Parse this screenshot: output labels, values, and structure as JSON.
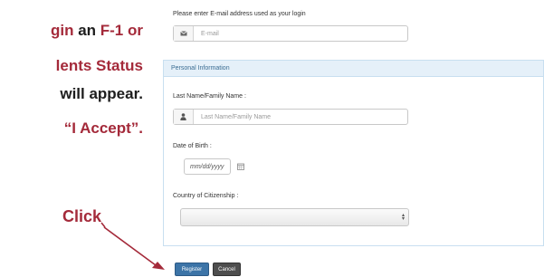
{
  "instructions": {
    "line1_red": "gin",
    "line1_dark": " an ",
    "line1_red2": "F-1 or",
    "line2": "lents Status",
    "line3": "will appear.",
    "line4": "“I Accept”."
  },
  "callout": {
    "click_label": "Click"
  },
  "form": {
    "email_instruction": "Please enter E-mail address used as your login",
    "email_placeholder": "E-mail",
    "section_title": "Personal Information",
    "last_name_label": "Last Name/Family Name :",
    "last_name_placeholder": "Last Name/Family Name",
    "dob_label": "Date of Birth :",
    "dob_placeholder": "mm/dd/yyyy",
    "country_label": "Country of Citizenship :",
    "country_value": ""
  },
  "buttons": {
    "register": "Register",
    "cancel": "Cancel"
  },
  "colors": {
    "accent_red": "#a42a3a",
    "primary_blue": "#3c74a7",
    "panel_header": "#e5f0f9"
  }
}
